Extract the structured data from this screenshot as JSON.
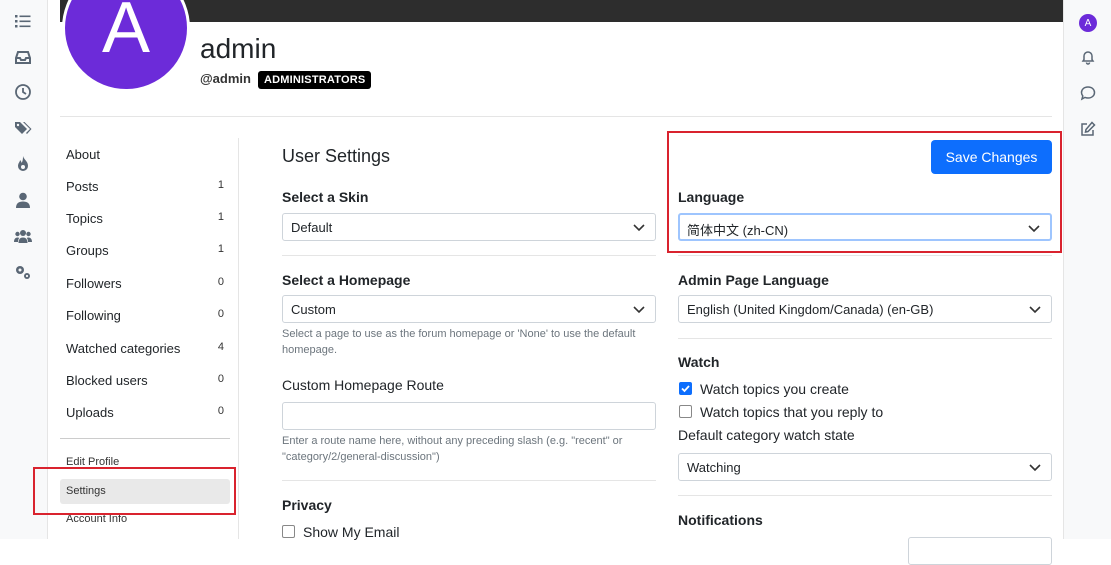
{
  "profile": {
    "avatar_letter": "A",
    "display_name": "admin",
    "username": "@admin",
    "group_badge": "ADMINISTRATORS",
    "mini_avatar_letter": "A"
  },
  "nav": {
    "items": [
      {
        "label": "About",
        "count": ""
      },
      {
        "label": "Posts",
        "count": "1"
      },
      {
        "label": "Topics",
        "count": "1"
      },
      {
        "label": "Groups",
        "count": "1"
      },
      {
        "label": "Followers",
        "count": "0"
      },
      {
        "label": "Following",
        "count": "0"
      },
      {
        "label": "Watched categories",
        "count": "4"
      },
      {
        "label": "Blocked users",
        "count": "0"
      },
      {
        "label": "Uploads",
        "count": "0"
      }
    ],
    "edit_profile": "Edit Profile",
    "settings": "Settings",
    "account_info": "Account Info"
  },
  "settings": {
    "title": "User Settings",
    "save_label": "Save Changes",
    "skin": {
      "label": "Select a Skin",
      "value": "Default"
    },
    "homepage": {
      "label": "Select a Homepage",
      "value": "Custom",
      "help": "Select a page to use as the forum homepage or 'None' to use the default homepage."
    },
    "custom_route": {
      "label": "Custom Homepage Route",
      "value": "",
      "help": "Enter a route name here, without any preceding slash (e.g. \"recent\" or \"category/2/general-discussion\")"
    },
    "privacy": {
      "label": "Privacy",
      "show_email": "Show My Email"
    },
    "language": {
      "label": "Language",
      "value": "简体中文 (zh-CN)"
    },
    "admin_language": {
      "label": "Admin Page Language",
      "value": "English (United Kingdom/Canada) (en-GB)"
    },
    "watch": {
      "label": "Watch",
      "watch_create": "Watch topics you create",
      "watch_create_checked": true,
      "watch_reply": "Watch topics that you reply to",
      "watch_reply_checked": false,
      "default_state_label": "Default category watch state",
      "default_state_value": "Watching"
    },
    "notifications": {
      "label": "Notifications"
    }
  },
  "icons": {
    "left_rail": [
      "list-icon",
      "inbox-icon",
      "clock-icon",
      "tags-icon",
      "fire-icon",
      "user-icon",
      "users-icon",
      "gears-icon"
    ],
    "right_rail": [
      "bell-icon",
      "chat-icon",
      "compose-icon"
    ]
  },
  "colors": {
    "accent": "#0d6efd",
    "avatar": "#6c2bd9",
    "highlight_box": "#d9232e"
  }
}
